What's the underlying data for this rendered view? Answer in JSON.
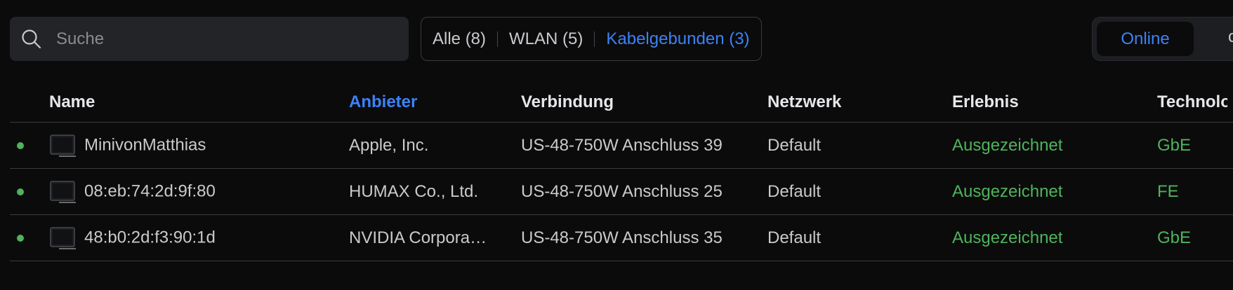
{
  "search": {
    "placeholder": "Suche",
    "icon": "search-icon"
  },
  "filters": [
    {
      "label": "Alle (8)",
      "active": false
    },
    {
      "label": "WLAN (5)",
      "active": false
    },
    {
      "label": "Kabelgebunden (3)",
      "active": true
    }
  ],
  "status_toggle": {
    "online": "Online",
    "offline": "of"
  },
  "table": {
    "headers": {
      "name": "Name",
      "vendor": "Anbieter",
      "connection": "Verbindung",
      "network": "Netzwerk",
      "experience": "Erlebnis",
      "technology": "Technolo"
    },
    "sorted_column": "vendor",
    "rows": [
      {
        "status": "online",
        "name": "MinivonMatthias",
        "vendor": "Apple, Inc.",
        "connection": "US-48-750W Anschluss 39",
        "network": "Default",
        "experience": "Ausgezeichnet",
        "technology": "GbE"
      },
      {
        "status": "online",
        "name": "08:eb:74:2d:9f:80",
        "vendor": "HUMAX Co., Ltd.",
        "connection": "US-48-750W Anschluss 25",
        "network": "Default",
        "experience": "Ausgezeichnet",
        "technology": "FE"
      },
      {
        "status": "online",
        "name": "48:b0:2d:f3:90:1d",
        "vendor": "NVIDIA Corpora…",
        "connection": "US-48-750W Anschluss 35",
        "network": "Default",
        "experience": "Ausgezeichnet",
        "technology": "GbE"
      }
    ]
  },
  "colors": {
    "accent": "#3c82f6",
    "status_online": "#4fb35b",
    "background": "#0b0b0c"
  },
  "icons": {
    "device": "desktop-monitor-icon",
    "status": "online-status-dot"
  }
}
